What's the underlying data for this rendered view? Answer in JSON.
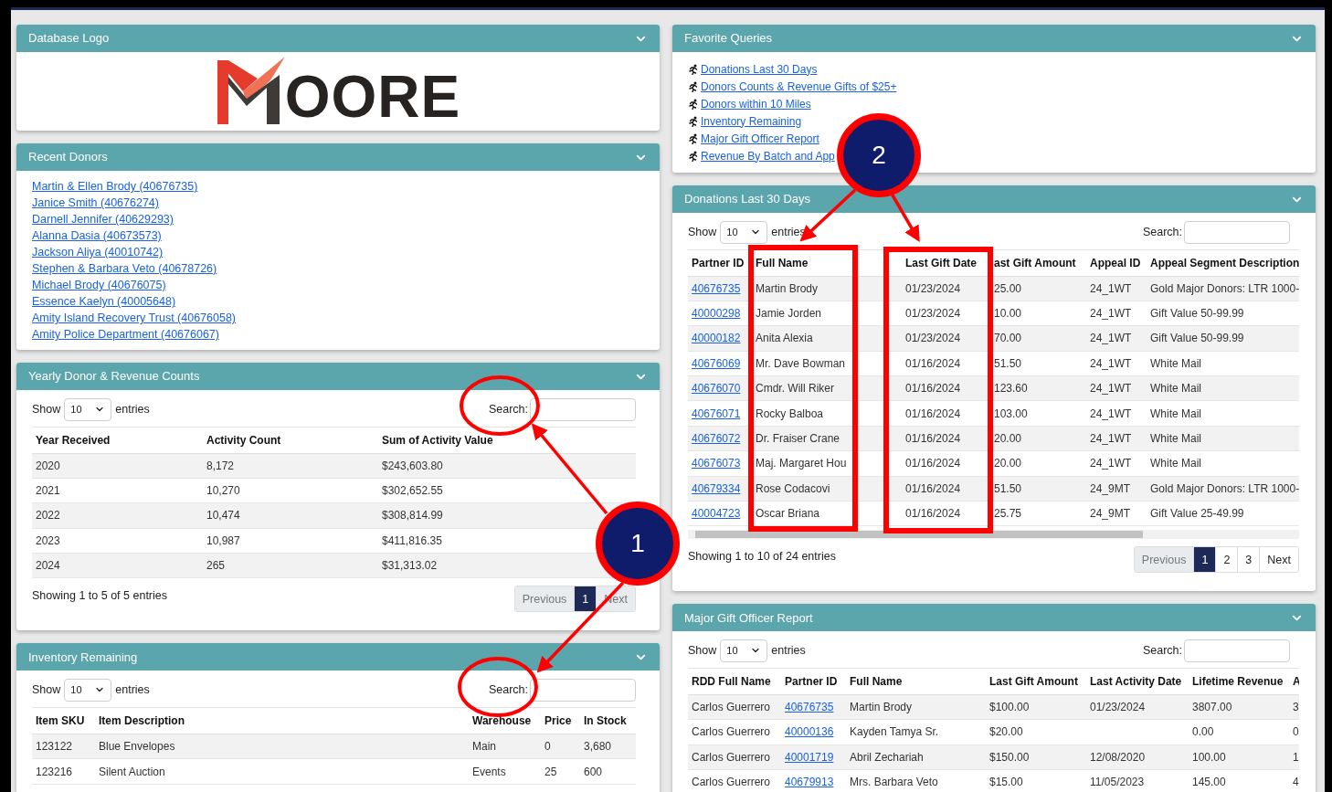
{
  "left_column": [
    {
      "kind": "logo",
      "title": "Database Logo",
      "logo_text": "OORE"
    },
    {
      "kind": "links",
      "title": "Recent Donors",
      "links": [
        "Martin & Ellen Brody (40676735)",
        "Janice Smith (40676274)",
        "Darnell Jennifer (40629293)",
        "Alanna Dasia (40673573)",
        "Jackson Aliya (40010742)",
        "Stephen & Barbara Veto (40678726)",
        "Michael Brody (40676075)",
        "Essence Kaelyn (40005648)",
        "Amity Island Recovery Trust (40676058)",
        "Amity Police Department (40676067)"
      ]
    },
    {
      "kind": "table",
      "title": "Yearly Donor & Revenue Counts",
      "show_label": "Show",
      "page_size": "10",
      "entries_label": "entries",
      "search_label": "Search:",
      "columns": [
        {
          "label": "Year Received",
          "kind": "text"
        },
        {
          "label": "Activity Count",
          "kind": "text"
        },
        {
          "label": "Sum of Activity Value",
          "kind": "text"
        }
      ],
      "rows": [
        [
          "2020",
          "8,172",
          "$243,603.80"
        ],
        [
          "2021",
          "10,270",
          "$302,652.55"
        ],
        [
          "2022",
          "10,474",
          "$308,814.99"
        ],
        [
          "2023",
          "10,987",
          "$411,816.35"
        ],
        [
          "2024",
          "265",
          "$31,313.02"
        ]
      ],
      "info": "Showing 1 to 5 of 5 entries",
      "pagination": [
        {
          "label": "Previous",
          "kind": "nav",
          "disabled": true
        },
        {
          "label": "1",
          "kind": "page",
          "selected": true
        },
        {
          "label": "Next",
          "kind": "nav",
          "disabled": true
        }
      ]
    },
    {
      "kind": "table",
      "title": "Inventory Remaining",
      "show_label": "Show",
      "page_size": "10",
      "entries_label": "entries",
      "search_label": "Search:",
      "columns": [
        {
          "label": "Item SKU",
          "kind": "text"
        },
        {
          "label": "Item Description",
          "kind": "text"
        },
        {
          "label": "Warehouse",
          "kind": "text"
        },
        {
          "label": "Price",
          "kind": "text"
        },
        {
          "label": "In Stock",
          "kind": "text"
        }
      ],
      "rows": [
        [
          "123122",
          "Blue Envelopes",
          "Main",
          "0",
          "3,680"
        ],
        [
          "123216",
          "Silent Auction",
          "Events",
          "25",
          "600"
        ]
      ]
    }
  ],
  "right_column": [
    {
      "kind": "queries",
      "title": "Favorite Queries",
      "links": [
        "Donations Last 30 Days",
        "Donors Counts & Revenue Gifts of $25+",
        "Donors within 10 Miles",
        "Inventory Remaining",
        "Major Gift Officer Report",
        "Revenue By Batch and App"
      ]
    },
    {
      "kind": "table",
      "title": "Donations Last 30 Days",
      "show_label": "Show",
      "page_size": "10",
      "entries_label": "entries",
      "search_label": "Search:",
      "columns": [
        {
          "label": "Partner ID",
          "kind": "link"
        },
        {
          "label": "Full Name",
          "kind": "text"
        },
        {
          "label": "Last Gift Date",
          "kind": "text"
        },
        {
          "label": "ast Gift Amount",
          "kind": "text"
        },
        {
          "label": "Appeal ID",
          "kind": "text"
        },
        {
          "label": "Appeal Segment Description",
          "kind": "text"
        }
      ],
      "rows": [
        [
          "40676735",
          "Martin Brody",
          "01/23/2024",
          "25.00",
          "24_1WT",
          "Gold Major Donors: LTR 1000-"
        ],
        [
          "40000298",
          "Jamie Jorden",
          "01/23/2024",
          "10.00",
          "24_1WT",
          "Gift Value 50-99.99"
        ],
        [
          "40000182",
          "Anita Alexia",
          "01/23/2024",
          "70.00",
          "24_1WT",
          "Gift Value 50-99.99"
        ],
        [
          "40676069",
          "Mr. Dave Bowman",
          "01/16/2024",
          "51.50",
          "24_1WT",
          "White Mail"
        ],
        [
          "40676070",
          "Cmdr. Will Riker",
          "01/16/2024",
          "123.60",
          "24_1WT",
          "White Mail"
        ],
        [
          "40676071",
          "Rocky Balboa",
          "01/16/2024",
          "103.00",
          "24_1WT",
          "White Mail"
        ],
        [
          "40676072",
          "Dr. Fraiser Crane",
          "01/16/2024",
          "20.00",
          "24_1WT",
          "White Mail"
        ],
        [
          "40676073",
          "Maj. Margaret Hou",
          "01/16/2024",
          "20.00",
          "24_1WT",
          "White Mail"
        ],
        [
          "40679334",
          "Rose Codacovi",
          "01/16/2024",
          "51.50",
          "24_9MT",
          "Gold Major Donors: LTR 1000-"
        ],
        [
          "40004723",
          "Oscar Briana",
          "01/16/2024",
          "25.75",
          "24_9MT",
          "Gift Value 25-49.99"
        ]
      ],
      "horizontal_scroll": true,
      "info": "Showing 1 to 10 of 24 entries",
      "pagination": [
        {
          "label": "Previous",
          "kind": "nav",
          "disabled": true
        },
        {
          "label": "1",
          "kind": "page",
          "selected": true
        },
        {
          "label": "2",
          "kind": "page",
          "selected": false
        },
        {
          "label": "3",
          "kind": "page",
          "selected": false
        },
        {
          "label": "Next",
          "kind": "nav",
          "disabled": false
        }
      ]
    },
    {
      "kind": "table",
      "title": "Major Gift Officer Report",
      "show_label": "Show",
      "page_size": "10",
      "entries_label": "entries",
      "search_label": "Search:",
      "columns": [
        {
          "label": "RDD Full Name",
          "kind": "text"
        },
        {
          "label": "Partner ID",
          "kind": "link"
        },
        {
          "label": "Full Name",
          "kind": "text"
        },
        {
          "label": "Last Gift Amount",
          "kind": "text"
        },
        {
          "label": "Last Activity Date",
          "kind": "text"
        },
        {
          "label": "Lifetime Revenue",
          "kind": "text"
        },
        {
          "label": "A",
          "kind": "text"
        }
      ],
      "rows": [
        [
          "Carlos Guerrero",
          "40676735",
          "Martin Brody",
          "$100.00",
          "01/23/2024",
          "3807.00",
          "3"
        ],
        [
          "Carlos Guerrero",
          "40000136",
          "Kayden Tamya Sr.",
          "$20.00",
          "",
          "0.00",
          "0"
        ],
        [
          "Carlos Guerrero",
          "40001719",
          "Abril Zechariah",
          "$150.00",
          "12/08/2020",
          "100.00",
          "1"
        ],
        [
          "Carlos Guerrero",
          "40679913",
          "Mrs. Barbara Veto",
          "$15.00",
          "11/05/2023",
          "145.00",
          "4"
        ]
      ]
    }
  ],
  "callouts": [
    {
      "label": "1"
    },
    {
      "label": "2"
    }
  ]
}
